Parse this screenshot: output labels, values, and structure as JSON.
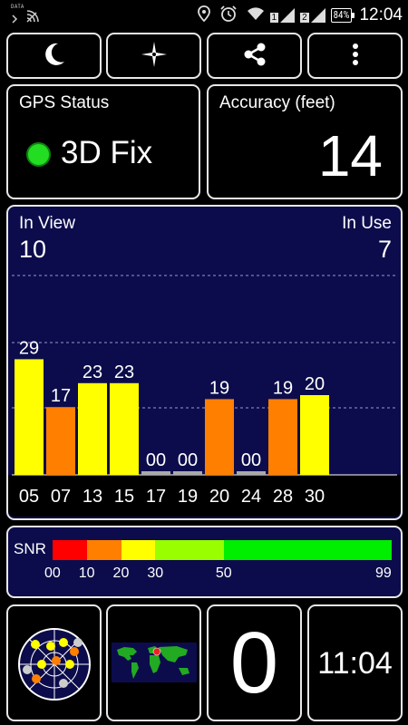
{
  "statusbar": {
    "data_label": "DATA",
    "sim1": "1",
    "sim2": "2",
    "battery": "84%",
    "time": "12:04",
    "icons": [
      "data-icon",
      "wifi-calling-icon",
      "location-icon",
      "alarm-icon",
      "wifi-icon",
      "signal-sim1-icon",
      "signal-sim2-icon",
      "battery-icon"
    ]
  },
  "toolbar": {
    "night_icon": "moon-icon",
    "compass_icon": "compass-icon",
    "share_icon": "share-icon",
    "menu_icon": "overflow-menu-icon"
  },
  "gps_status": {
    "title": "GPS Status",
    "fix": "3D Fix",
    "fix_color": "#22dd22"
  },
  "accuracy": {
    "title": "Accuracy (feet)",
    "value": "14"
  },
  "satellites": {
    "in_view_label": "In View",
    "in_view": "10",
    "in_use_label": "In Use",
    "in_use": "7"
  },
  "chart_data": {
    "type": "bar",
    "categories": [
      "05",
      "07",
      "13",
      "15",
      "17",
      "19",
      "20",
      "24",
      "28",
      "30"
    ],
    "values": [
      29,
      17,
      23,
      23,
      0,
      0,
      19,
      0,
      19,
      20
    ],
    "value_labels": [
      "29",
      "17",
      "23",
      "23",
      "00",
      "00",
      "19",
      "00",
      "19",
      "20"
    ],
    "colors": [
      "#ffff00",
      "#ff7f00",
      "#ffff00",
      "#ffff00",
      "#aaaaaa",
      "#aaaaaa",
      "#ff7f00",
      "#aaaaaa",
      "#ff7f00",
      "#ffff00"
    ],
    "ylim": [
      0,
      50
    ],
    "grid": true
  },
  "snr": {
    "label": "SNR",
    "segments": [
      {
        "from": 0,
        "to": 10,
        "color": "#ff0000"
      },
      {
        "from": 10,
        "to": 20,
        "color": "#ff7f00"
      },
      {
        "from": 20,
        "to": 30,
        "color": "#ffff00"
      },
      {
        "from": 30,
        "to": 50,
        "color": "#99ff00"
      },
      {
        "from": 50,
        "to": 99,
        "color": "#00ee00"
      }
    ],
    "ticks": [
      "00",
      "10",
      "20",
      "30",
      "50",
      "99"
    ]
  },
  "tiles": {
    "radar_icon": "sky-radar-icon",
    "map_icon": "world-map-icon",
    "zero": "0",
    "time": "11:04"
  }
}
